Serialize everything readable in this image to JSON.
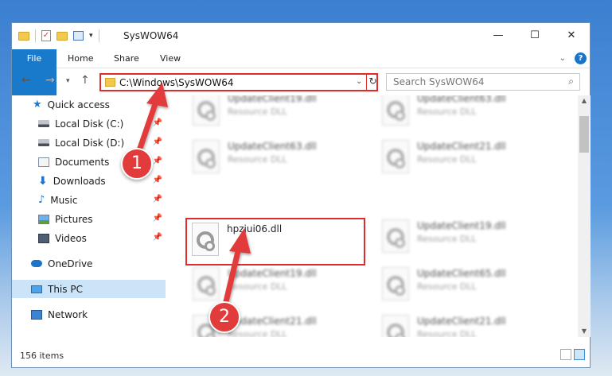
{
  "window": {
    "title": "SysWOW64",
    "controls": {
      "minimize": "—",
      "maximize": "☐",
      "close": "✕"
    }
  },
  "ribbon": {
    "tabs": [
      "File",
      "Home",
      "Share",
      "View"
    ],
    "help": "?"
  },
  "address": {
    "path": "C:\\Windows\\SysWOW64",
    "refresh": "↻"
  },
  "search": {
    "placeholder": "Search SysWOW64"
  },
  "sidebar": {
    "items": [
      {
        "label": "Quick access",
        "icon": "star-icon"
      },
      {
        "label": "Local Disk (C:)",
        "icon": "disk-icon",
        "pinned": true
      },
      {
        "label": "Local Disk (D:)",
        "icon": "disk-icon",
        "pinned": true
      },
      {
        "label": "Documents",
        "icon": "documents-icon",
        "pinned": true
      },
      {
        "label": "Downloads",
        "icon": "download-icon",
        "pinned": true
      },
      {
        "label": "Music",
        "icon": "music-icon",
        "pinned": true
      },
      {
        "label": "Pictures",
        "icon": "pictures-icon",
        "pinned": true
      },
      {
        "label": "Videos",
        "icon": "videos-icon",
        "pinned": true
      },
      {
        "label": "OneDrive",
        "icon": "cloud-icon"
      },
      {
        "label": "This PC",
        "icon": "computer-icon",
        "selected": true
      },
      {
        "label": "Network",
        "icon": "network-icon"
      }
    ]
  },
  "files": [
    {
      "name": "UpdateClient19.dll",
      "type": "Resource DLL"
    },
    {
      "name": "UpdateClient63.dll",
      "type": "Resource DLL"
    },
    {
      "name": "UpdateClient63.dll",
      "type": "Resource DLL"
    },
    {
      "name": "UpdateClient21.dll",
      "type": "Resource DLL"
    },
    {
      "name": "hpzjui06.dll",
      "type": "",
      "highlighted": true
    },
    {
      "name": "UpdateClient19.dll",
      "type": "Resource DLL"
    },
    {
      "name": "UpdateClient19.dll",
      "type": "Resource DLL"
    },
    {
      "name": "UpdateClient65.dll",
      "type": "Resource DLL"
    },
    {
      "name": "UpdateClient21.dll",
      "type": "Resource DLL"
    },
    {
      "name": "UpdateClient21.dll",
      "type": "Resource DLL"
    }
  ],
  "status": {
    "item_count": "156 items"
  },
  "annotations": {
    "step1": "1",
    "step2": "2",
    "color": "#e23b3b"
  }
}
